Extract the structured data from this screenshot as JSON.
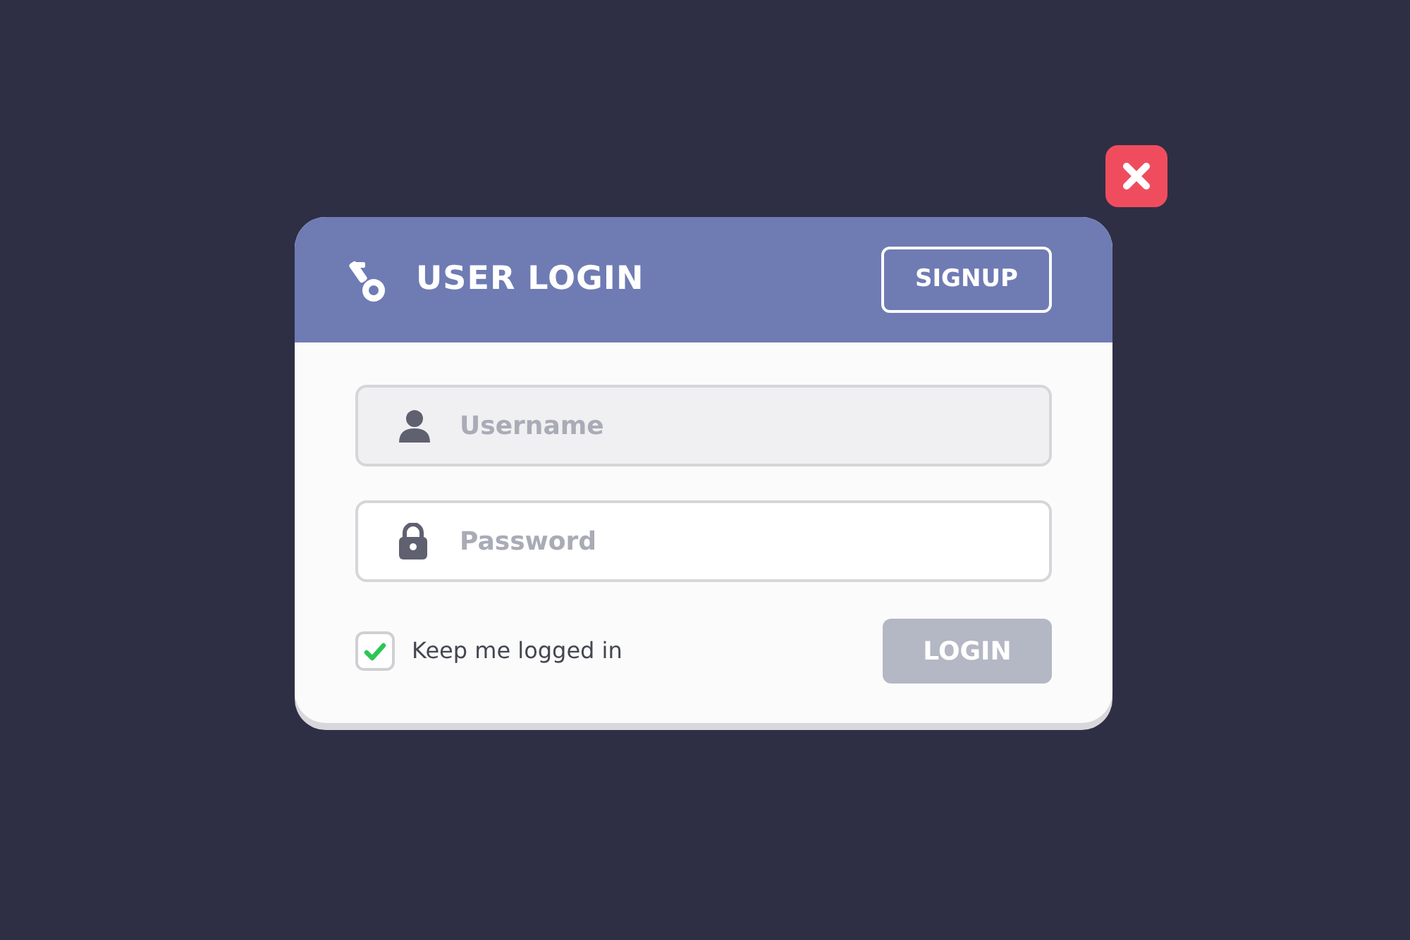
{
  "dialog": {
    "title": "USER LOGIN",
    "signup_button": "SIGNUP",
    "fields": [
      {
        "kind": "user",
        "placeholder": "Username",
        "focused": true
      },
      {
        "kind": "lock",
        "placeholder": "Password",
        "focused": false
      }
    ],
    "remember": {
      "label": "Keep me logged in",
      "checked": true
    },
    "login_button": {
      "label": "LOGIN",
      "disabled": true
    }
  }
}
